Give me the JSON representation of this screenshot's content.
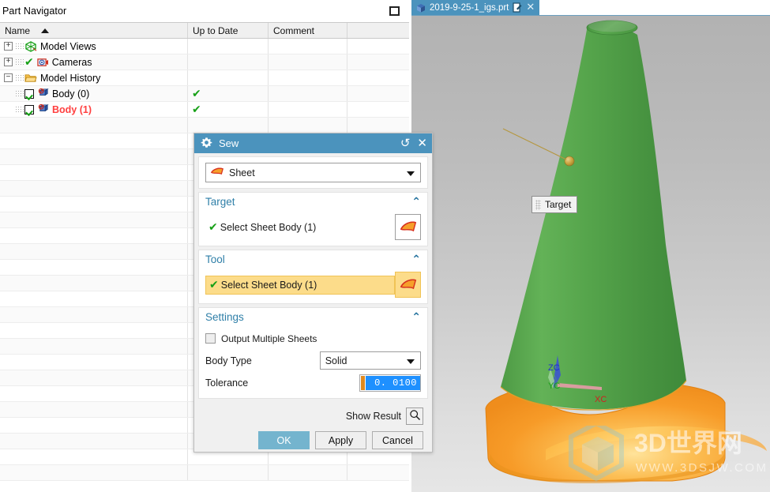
{
  "part_navigator": {
    "title": "Part Navigator",
    "restore_icon": "restore-window-icon",
    "columns": [
      "Name",
      "Up to Date",
      "Comment",
      ""
    ],
    "sort_column": "Name",
    "sort_direction": "ascending",
    "rows": [
      {
        "name": "Model Views",
        "up_to_date": "",
        "comment": "",
        "level": 0,
        "expander": "+",
        "icon": "model-views-icon",
        "checked": false,
        "has_check_mark": false,
        "red": false
      },
      {
        "name": "Cameras",
        "up_to_date": "",
        "comment": "",
        "level": 0,
        "expander": "+",
        "icon": "cameras-icon",
        "checked": false,
        "has_check_mark": true,
        "red": false
      },
      {
        "name": "Model History",
        "up_to_date": "",
        "comment": "",
        "level": 0,
        "expander": "−",
        "icon": "folder-icon",
        "checked": false,
        "has_check_mark": false,
        "red": false
      },
      {
        "name": "Body (0)",
        "up_to_date": "✔",
        "comment": "",
        "level": 1,
        "expander": "",
        "icon": "body-icon",
        "checked": true,
        "has_check_mark": false,
        "red": false
      },
      {
        "name": "Body (1)",
        "up_to_date": "✔",
        "comment": "",
        "level": 1,
        "expander": "",
        "icon": "body-icon",
        "checked": true,
        "has_check_mark": false,
        "red": true
      }
    ],
    "empty_row_count": 23
  },
  "tab_bar": {
    "active_tab": {
      "label": "2019-9-25-1_igs.prt",
      "doc_icon": "nx-part-icon",
      "modified_icon": "edit-document-icon",
      "close_icon": "close-icon",
      "close_glyph": "✕"
    }
  },
  "viewport": {
    "callout": {
      "label": "Target",
      "grip_icon": "drag-grip-icon"
    },
    "triad": {
      "x_label": "XC",
      "y_label": "YC",
      "z_label": "ZC",
      "x_color": "#d02020",
      "y_color": "#1aa01a",
      "z_color": "#2030d0"
    },
    "model": {
      "target_body_color": "#4f9f46",
      "tool_body_color": "#f79b28",
      "point_marker_color": "#c8a23c"
    },
    "watermark": {
      "text_cn": "3D世界网",
      "text_url": "WWW.3DSJW.COM",
      "logo_icon": "hex-cube-logo-icon"
    }
  },
  "sew_dialog": {
    "title": "Sew",
    "title_icon": "gear-icon",
    "reset_icon": "reset-icon",
    "reset_glyph": "↺",
    "close_icon": "close-icon",
    "close_glyph": "✕",
    "type": {
      "value": "Sheet",
      "icon": "sheet-body-icon"
    },
    "target": {
      "heading": "Target",
      "collapse_glyph": "⌃",
      "select_label": "Select Sheet Body (1)",
      "select_check": "✔",
      "select_icon": "sheet-body-icon"
    },
    "tool": {
      "heading": "Tool",
      "collapse_glyph": "⌃",
      "select_label": "Select Sheet Body (1)",
      "select_check": "✔",
      "select_icon": "sheet-body-icon"
    },
    "settings": {
      "heading": "Settings",
      "collapse_glyph": "⌃",
      "output_multiple_sheets_label": "Output Multiple Sheets",
      "output_multiple_sheets_checked": false,
      "body_type_label": "Body Type",
      "body_type_value": "Solid",
      "tolerance_label": "Tolerance",
      "tolerance_value": "0. 0100"
    },
    "show_result": {
      "label": "Show Result",
      "icon": "magnifier-icon"
    },
    "buttons": {
      "ok": "OK",
      "apply": "Apply",
      "cancel": "Cancel"
    }
  }
}
